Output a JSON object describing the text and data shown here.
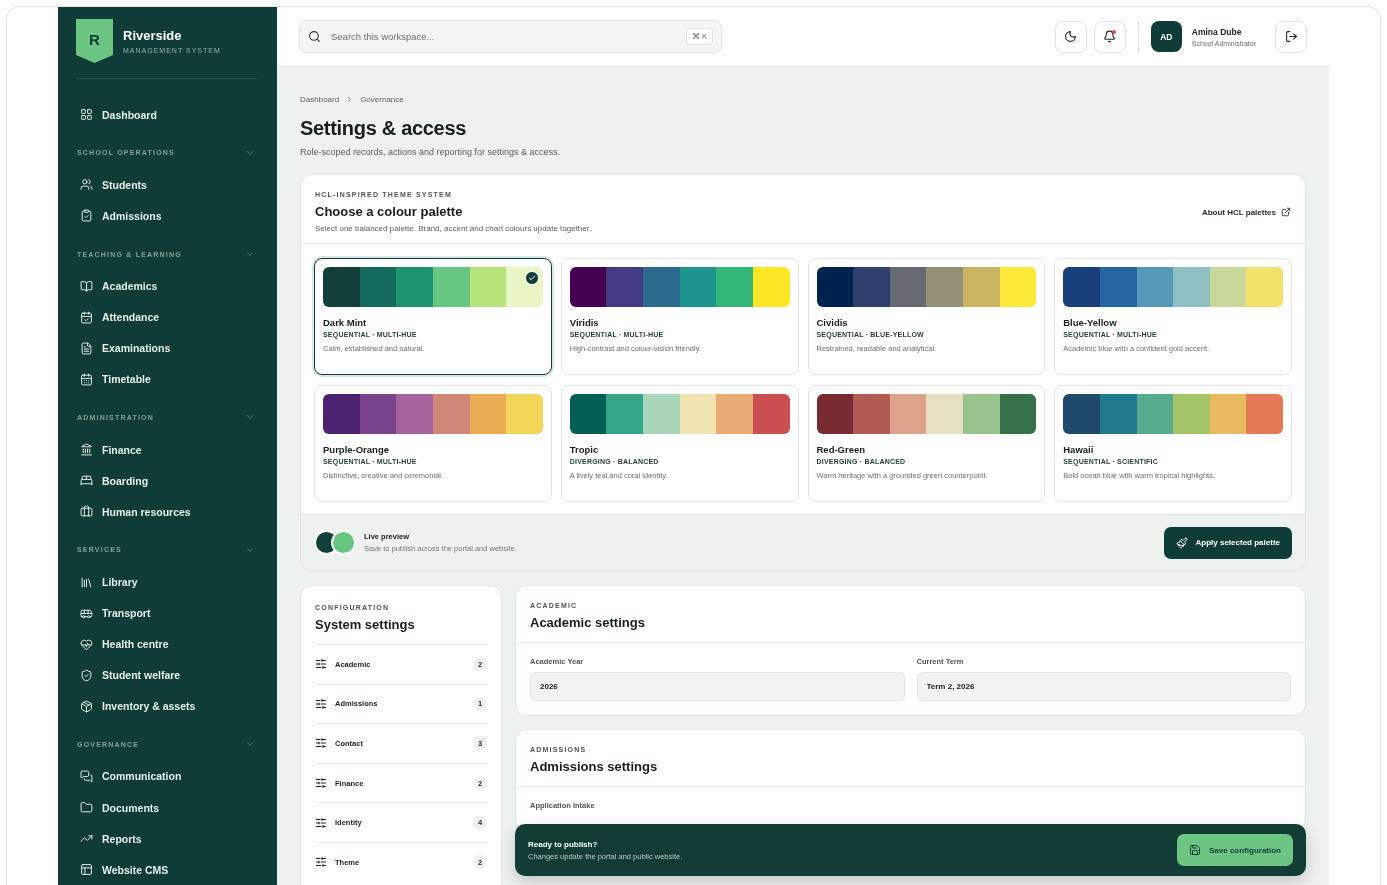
{
  "brand": {
    "logo_letter": "R",
    "name": "Riverside",
    "tagline": "MANAGEMENT SYSTEM"
  },
  "sidebar": {
    "top_items": [
      {
        "label": "Dashboard"
      }
    ],
    "sections": [
      {
        "title": "SCHOOL OPERATIONS",
        "expanded": true,
        "items": [
          {
            "label": "Students"
          },
          {
            "label": "Admissions"
          }
        ]
      },
      {
        "title": "TEACHING & LEARNING",
        "expanded": true,
        "items": [
          {
            "label": "Academics"
          },
          {
            "label": "Attendance"
          },
          {
            "label": "Examinations"
          },
          {
            "label": "Timetable"
          }
        ]
      },
      {
        "title": "ADMINISTRATION",
        "expanded": true,
        "items": [
          {
            "label": "Finance"
          },
          {
            "label": "Boarding"
          },
          {
            "label": "Human resources"
          }
        ]
      },
      {
        "title": "SERVICES",
        "expanded": true,
        "items": [
          {
            "label": "Library"
          },
          {
            "label": "Transport"
          },
          {
            "label": "Health centre"
          },
          {
            "label": "Student welfare"
          },
          {
            "label": "Inventory & assets"
          }
        ]
      },
      {
        "title": "GOVERNANCE",
        "expanded": true,
        "items": [
          {
            "label": "Communication"
          },
          {
            "label": "Documents"
          },
          {
            "label": "Reports"
          },
          {
            "label": "Website CMS"
          }
        ]
      }
    ]
  },
  "header": {
    "search": {
      "placeholder": "Search this workspace...",
      "shortcut": "⌘ K"
    },
    "notifications_unread": true,
    "user": {
      "initials": "AD",
      "name": "Amina Dube",
      "role": "School Administrator"
    }
  },
  "breadcrumb": [
    "Dashboard",
    "Governance"
  ],
  "page": {
    "title": "Settings & access",
    "subtitle": "Role-scoped records, actions and reporting for settings & access."
  },
  "palette_panel": {
    "eyebrow": "HCL-INSPIRED THEME SYSTEM",
    "title": "Choose a colour palette",
    "description": "Select one balanced palette. Brand, accent and chart colours update together.",
    "link": "About HCL palettes",
    "palettes": [
      {
        "name": "Dark Mint",
        "tags": "SEQUENTIAL · MULTI-HUE",
        "description": "Calm, established and natural.",
        "selected": true,
        "swatches": [
          {
            "color": "#123f38"
          },
          {
            "color": "#136a5d"
          },
          {
            "color": "#1c9470"
          },
          {
            "color": "#66c682"
          },
          {
            "color": "#b8e57a"
          },
          {
            "color": "#eaf5c6"
          }
        ]
      },
      {
        "name": "Viridis",
        "tags": "SEQUENTIAL · MULTI-HUE",
        "description": "High-contrast and colour-vision friendly.",
        "selected": false,
        "swatches": [
          {
            "color": "#440154"
          },
          {
            "color": "#433a84"
          },
          {
            "color": "#2c6a8d"
          },
          {
            "color": "#1f948c"
          },
          {
            "color": "#34b779"
          },
          {
            "color": "#fde725"
          }
        ]
      },
      {
        "name": "Cividis",
        "tags": "SEQUENTIAL · BLUE-YELLOW",
        "description": "Restrained, readable and analytical.",
        "selected": false,
        "swatches": [
          {
            "color": "#00224e"
          },
          {
            "color": "#2e3f6c"
          },
          {
            "color": "#666970"
          },
          {
            "color": "#958f78"
          },
          {
            "color": "#cab461"
          },
          {
            "color": "#fee838"
          }
        ]
      },
      {
        "name": "Blue-Yellow",
        "tags": "SEQUENTIAL · MULTI-HUE",
        "description": "Academic blue with a confident gold accent.",
        "selected": false,
        "swatches": [
          {
            "color": "#193f7a"
          },
          {
            "color": "#2565a0"
          },
          {
            "color": "#5598b7"
          },
          {
            "color": "#8fbfc3"
          },
          {
            "color": "#c9d99b"
          },
          {
            "color": "#f1e168"
          }
        ]
      },
      {
        "name": "Purple-Orange",
        "tags": "SEQUENTIAL · MULTI-HUE",
        "description": "Distinctive, creative and ceremonial.",
        "selected": false,
        "swatches": [
          {
            "color": "#4a2270"
          },
          {
            "color": "#79438e"
          },
          {
            "color": "#a6639b"
          },
          {
            "color": "#cf8778"
          },
          {
            "color": "#ebab55"
          },
          {
            "color": "#f2d65a"
          }
        ]
      },
      {
        "name": "Tropic",
        "tags": "DIVERGING · BALANCED",
        "description": "A lively teal and coral identity.",
        "selected": false,
        "swatches": [
          {
            "color": "#035e55"
          },
          {
            "color": "#36a688"
          },
          {
            "color": "#a9d6b9"
          },
          {
            "color": "#f0e4b3"
          },
          {
            "color": "#eaaa73"
          },
          {
            "color": "#cb4f50"
          }
        ]
      },
      {
        "name": "Red-Green",
        "tags": "DIVERGING · BALANCED",
        "description": "Warm heritage with a grounded green counterpoint.",
        "selected": false,
        "swatches": [
          {
            "color": "#7a2a32"
          },
          {
            "color": "#b25b55"
          },
          {
            "color": "#dca38a"
          },
          {
            "color": "#e6e0c2"
          },
          {
            "color": "#98c38c"
          },
          {
            "color": "#357048"
          }
        ]
      },
      {
        "name": "Hawaii",
        "tags": "SEQUENTIAL · SCIENTIFIC",
        "description": "Bold ocean blue with warm tropical highlights.",
        "selected": false,
        "swatches": [
          {
            "color": "#204a6c"
          },
          {
            "color": "#217b8c"
          },
          {
            "color": "#56aa8e"
          },
          {
            "color": "#a3c568"
          },
          {
            "color": "#e8b95e"
          },
          {
            "color": "#e37a55"
          }
        ]
      }
    ],
    "preview": {
      "title": "Live preview",
      "description": "Save to publish across the portal and website."
    },
    "apply_button": "Apply selected palette"
  },
  "configuration": {
    "eyebrow": "CONFIGURATION",
    "title": "System settings",
    "items": [
      {
        "label": "Academic",
        "count": "2"
      },
      {
        "label": "Admissions",
        "count": "1"
      },
      {
        "label": "Contact",
        "count": "3"
      },
      {
        "label": "Finance",
        "count": "2"
      },
      {
        "label": "Identity",
        "count": "4"
      },
      {
        "label": "Theme",
        "count": "2"
      }
    ]
  },
  "settings_groups": [
    {
      "eyebrow": "ACADEMIC",
      "title": "Academic settings",
      "fields": [
        {
          "label": "Academic Year",
          "value": "2026"
        },
        {
          "label": "Current Term",
          "value": "Term 2, 2026"
        }
      ]
    },
    {
      "eyebrow": "ADMISSIONS",
      "title": "Admissions settings",
      "fields": [
        {
          "label": "Application Intake"
        }
      ]
    }
  ],
  "publish_bar": {
    "title": "Ready to publish?",
    "description": "Changes update the portal and public website.",
    "button": "Save configuration"
  }
}
